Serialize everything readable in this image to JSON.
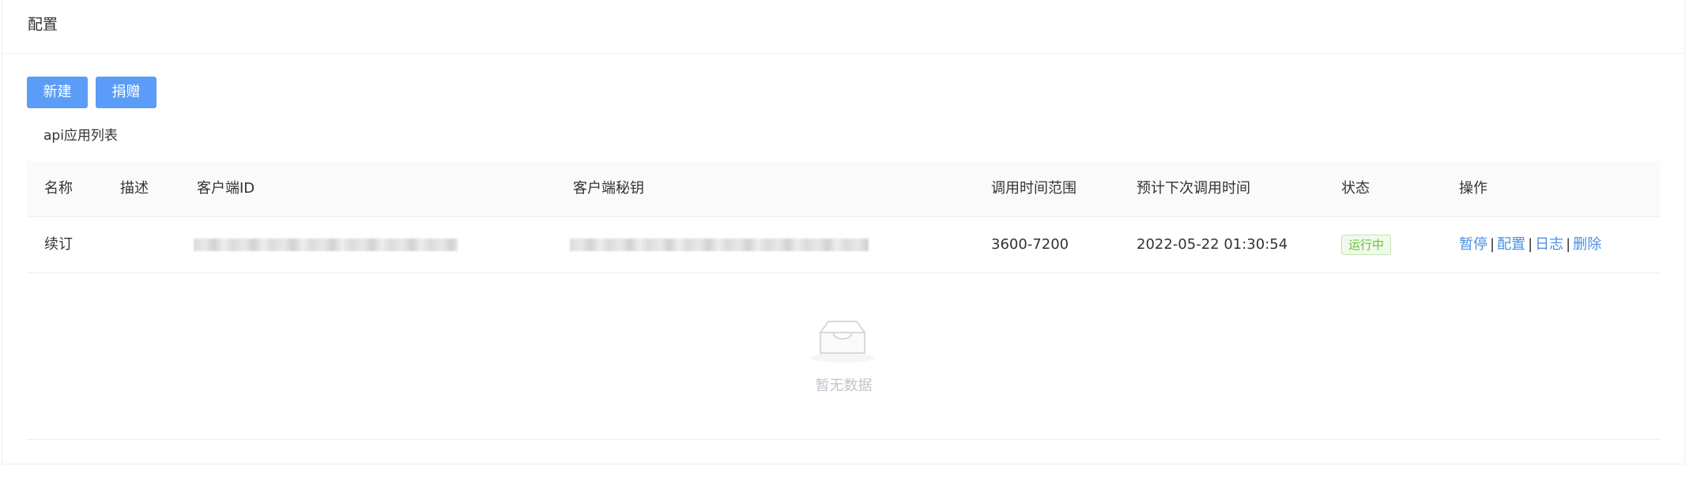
{
  "card": {
    "title": "配置"
  },
  "toolbar": {
    "new_label": "新建",
    "donate_label": "捐赠"
  },
  "list": {
    "title": "api应用列表"
  },
  "table": {
    "columns": [
      "名称",
      "描述",
      "客户端ID",
      "客户端秘钥",
      "调用时间范围",
      "预计下次调用时间",
      "状态",
      "操作"
    ],
    "rows": [
      {
        "name": "续订",
        "description": "",
        "client_id": "",
        "client_secret": "",
        "time_range": "3600-7200",
        "next_call": "2022-05-22 01:30:54",
        "status": "运行中",
        "actions": [
          "暂停",
          "配置",
          "日志",
          "删除"
        ]
      }
    ],
    "separator": "|",
    "empty_text": "暂无数据"
  },
  "colors": {
    "primary": "#5a9cf8",
    "link": "#4a90e2",
    "success": "#67c23a",
    "muted": "#c0c4cc"
  },
  "icons": {
    "empty": "empty-inbox-icon"
  }
}
